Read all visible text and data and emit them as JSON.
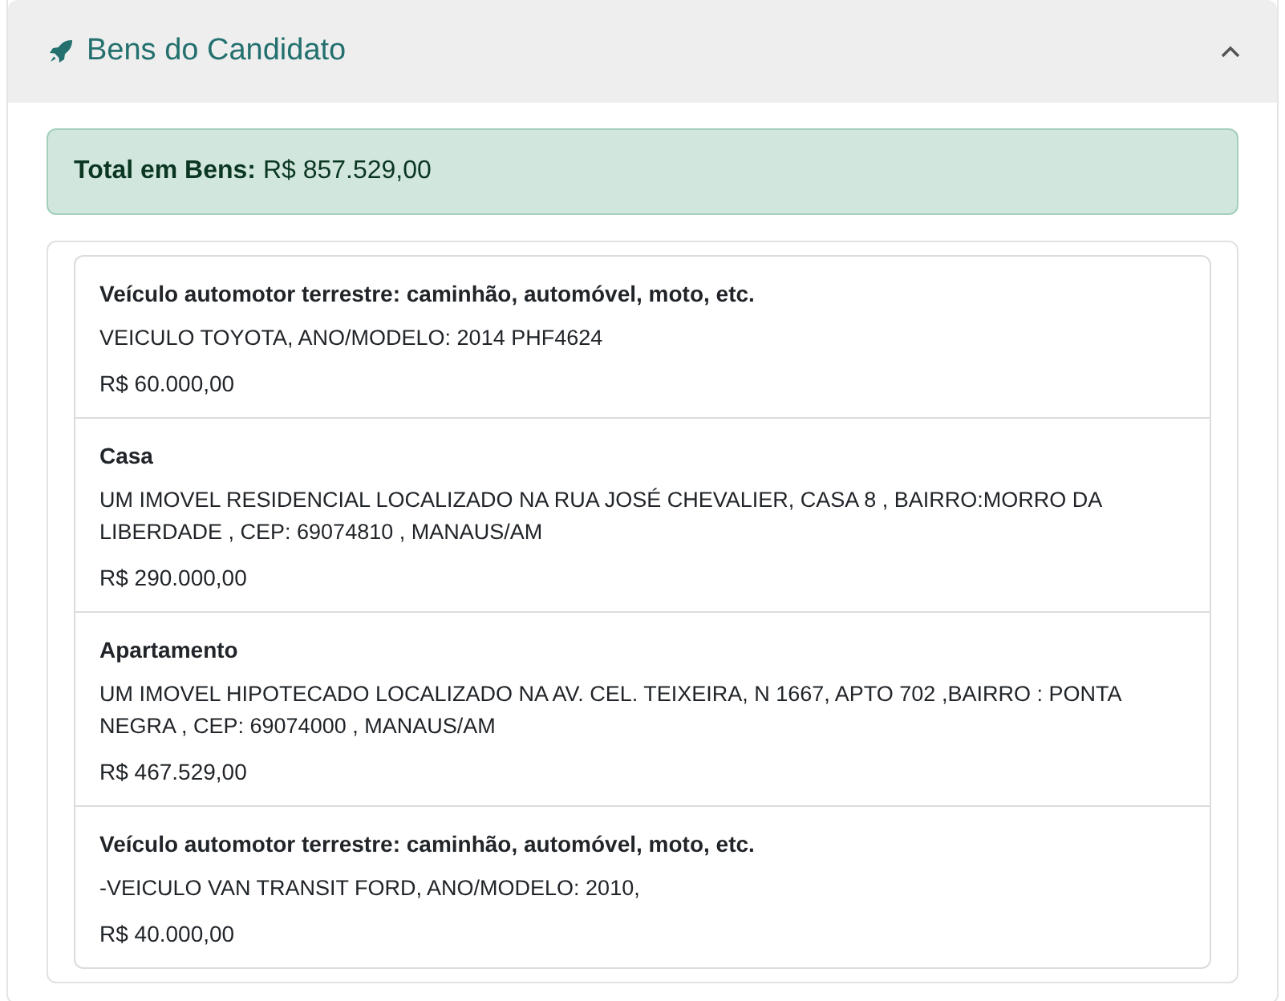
{
  "panel": {
    "title": "Bens do Candidato",
    "expanded": true
  },
  "total": {
    "label": "Total em Bens:",
    "value": "R$ 857.529,00"
  },
  "assets": [
    {
      "type": "Veículo automotor terrestre: caminhão, automóvel, moto, etc.",
      "description": "VEICULO TOYOTA, ANO/MODELO: 2014 PHF4624",
      "value": "R$ 60.000,00"
    },
    {
      "type": "Casa",
      "description": "UM IMOVEL RESIDENCIAL LOCALIZADO NA RUA JOSÉ CHEVALIER, CASA 8 , BAIRRO:MORRO DA LIBERDADE , CEP: 69074810 , MANAUS/AM",
      "value": "R$ 290.000,00"
    },
    {
      "type": "Apartamento",
      "description": "UM IMOVEL HIPOTECADO LOCALIZADO NA AV. CEL. TEIXEIRA, N 1667, APTO 702 ,BAIRRO : PONTA NEGRA , CEP: 69074000 , MANAUS/AM",
      "value": "R$ 467.529,00"
    },
    {
      "type": "Veículo automotor terrestre: caminhão, automóvel, moto, etc.",
      "description": "-VEICULO VAN TRANSIT FORD, ANO/MODELO: 2010,",
      "value": "R$ 40.000,00"
    }
  ]
}
